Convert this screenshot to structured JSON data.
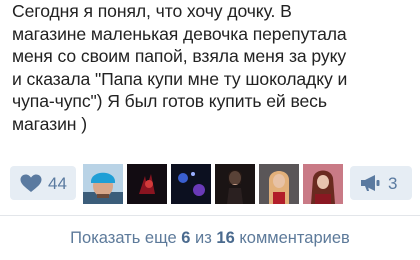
{
  "post": {
    "text_lines": [
      "Сегодня я понял, что хочу дочку. В",
      "магазине маленькая девочка перепутала",
      "меня со своим папой, взяла меня за руку",
      "и сказала \"Папа купи мне ту шоколадку и",
      "чупа-чупс\") Я был готов купить ей весь",
      "магазин )"
    ]
  },
  "actions": {
    "like_icon": "heart-icon",
    "like_count": "44",
    "share_icon": "megaphone-icon",
    "share_count": "3",
    "accent_color": "#5a7aa0",
    "button_bg": "#e6edf4"
  },
  "liked_by": [
    {
      "name": "avatar-1"
    },
    {
      "name": "avatar-2"
    },
    {
      "name": "avatar-3"
    },
    {
      "name": "avatar-4"
    },
    {
      "name": "avatar-5"
    },
    {
      "name": "avatar-6"
    }
  ],
  "comments": {
    "prefix": "Показать еще",
    "shown": "6",
    "middle": "из",
    "total": "16",
    "suffix": "комментариев"
  }
}
